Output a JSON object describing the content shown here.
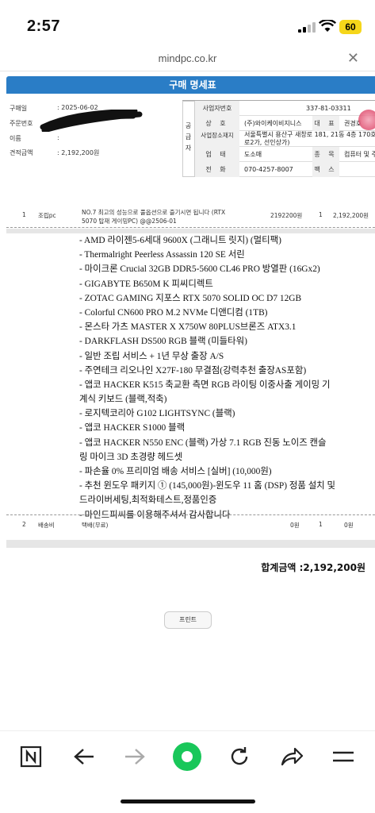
{
  "status_bar": {
    "time": "2:57",
    "battery": "60"
  },
  "browser": {
    "url": "mindpc.co.kr"
  },
  "doc": {
    "title": "구매 명세표",
    "buyer": [
      {
        "key": "구매일",
        "value": ": 2025-06-02"
      },
      {
        "key": "주문번호",
        "value": ":"
      },
      {
        "key": "이름",
        "value": ":"
      },
      {
        "key": "견적금액",
        "value": ": 2,192,200원"
      }
    ],
    "supplier": {
      "side_label": "공급자",
      "reg_label": "사업자번호",
      "reg_no": "337-81-03311",
      "company_label": "상 호",
      "company": "(주)와이케이비지니스",
      "ceo_label": "대 표",
      "ceo": "권경호",
      "addr_label": "사업장소재지",
      "address_1": "서울특별시 용산구 새창로 181, 21동 4층 170호(한강",
      "address_2": "로2가, 선인상가)",
      "type_label": "업 태",
      "biz_type": "도소매",
      "item_label": "종 목",
      "biz_item": "컴퓨터 및 주변기기",
      "tel_label": "전 화",
      "tel": "070-4257-8007",
      "fax_label": "팩 스"
    },
    "items": [
      {
        "no": "1",
        "category": "조립pc",
        "name_1": "NO.7 최고의 성능으로 풀옵션으로 즐기시면 됩니다 (RTX",
        "name_2": "5070 탑재 게이밍PC) @@2506-01",
        "price": "2192200원",
        "qty": "1",
        "amount": "2,192,200원"
      },
      {
        "no": "2",
        "category": "배송비",
        "name_1": "택배(무료)",
        "price": "0원",
        "qty": "1",
        "amount": "0원"
      }
    ],
    "description": [
      "- AMD 라이젠5-6세대 9600X (그래니트 릿지) (멀티팩)",
      "- Thermalright Peerless Assassin 120 SE 서린",
      "- 마이크론 Crucial 32GB DDR5-5600 CL46 PRO 방열판 (16Gx2)",
      "- GIGABYTE B650M K 피씨디렉트",
      "- ZOTAC GAMING 지포스 RTX 5070 SOLID OC D7 12GB",
      "- Colorful CN600 PRO M.2 NVMe 디앤디컴 (1TB)",
      "- 몬스타 가츠 MASTER X X750W 80PLUS브론즈 ATX3.1",
      "- DARKFLASH DS500 RGB 블랙 (미들타워)",
      "- 일반 조립 서비스 + 1년 무상 출장 A/S",
      "- 주연테크 리오나인 X27F-180 무결점(강력추천 출장AS포함)",
      "- 앱코 HACKER K515 축교환 측면 RGB 라이팅 이중사출 게이밍 기",
      "계식 키보드 (블랙,적축)",
      "- 로지텍코리아 G102 LIGHTSYNC (블랙)",
      "- 앱코 HACKER S1000 블랙",
      "- 앱코 HACKER N550 ENC (블랙) 가상 7.1 RGB 진동 노이즈 캔슬",
      "링 마이크 3D 초경량 헤드셋",
      "- 파손율 0% 프리미엄 배송 서비스 [실버] (10,000원)",
      "- 추천 윈도우 패키지 ① (145,000원)-윈도우 11 홈 (DSP) 정품 설치 및",
      "드라이버세팅,최적화테스트,정품인증",
      "- 마인드피씨를 이용해주셔서 감사합니다"
    ],
    "total": "합계금액 :2,192,200원",
    "print_label": "프린트"
  },
  "toolbar": {
    "icons": [
      "naver-n-icon",
      "back-arrow-icon",
      "forward-arrow-icon",
      "home-circle-icon",
      "reload-icon",
      "share-icon",
      "menu-icon"
    ]
  }
}
